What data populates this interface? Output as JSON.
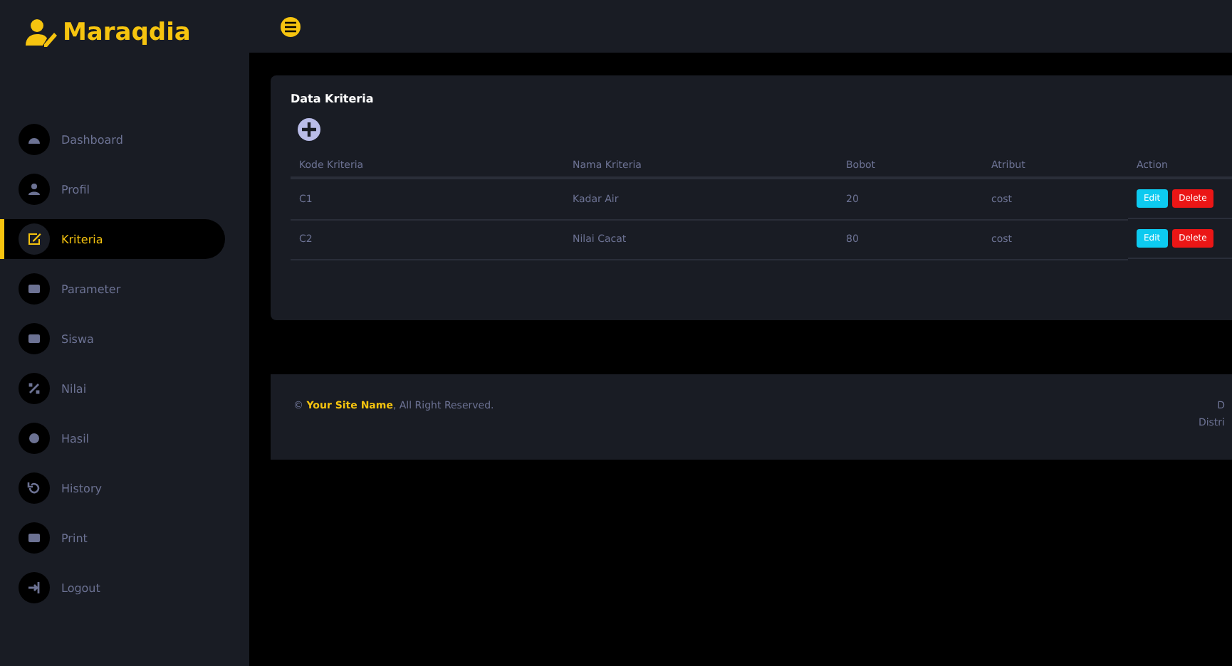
{
  "brand": "Maraqdia",
  "menu": [
    {
      "label": "Dashboard",
      "selected": false
    },
    {
      "label": "Profil",
      "selected": false
    },
    {
      "label": "Kriteria",
      "selected": true
    },
    {
      "label": "Parameter",
      "selected": false
    },
    {
      "label": "Siswa",
      "selected": false
    },
    {
      "label": "Nilai",
      "selected": false
    },
    {
      "label": "Hasil",
      "selected": false
    },
    {
      "label": "History",
      "selected": false
    },
    {
      "label": "Print",
      "selected": false
    },
    {
      "label": "Logout",
      "selected": false
    }
  ],
  "card": {
    "title": "Data Kriteria",
    "columns": [
      "Kode Kriteria",
      "Nama Kriteria",
      "Bobot",
      "Atribut",
      "Action"
    ],
    "rows": [
      {
        "cells": [
          "C1",
          "Kadar Air",
          "20",
          "cost"
        ],
        "actions": [
          "Edit",
          "Delete"
        ]
      },
      {
        "cells": [
          "C2",
          "Nilai Cacat",
          "80",
          "cost"
        ],
        "actions": [
          "Edit",
          "Delete"
        ]
      }
    ]
  },
  "footer": {
    "copy": "©",
    "site": "Your Site Name",
    "rights": ", All Right Reserved.",
    "right_lines": [
      "D",
      "Distri"
    ]
  }
}
